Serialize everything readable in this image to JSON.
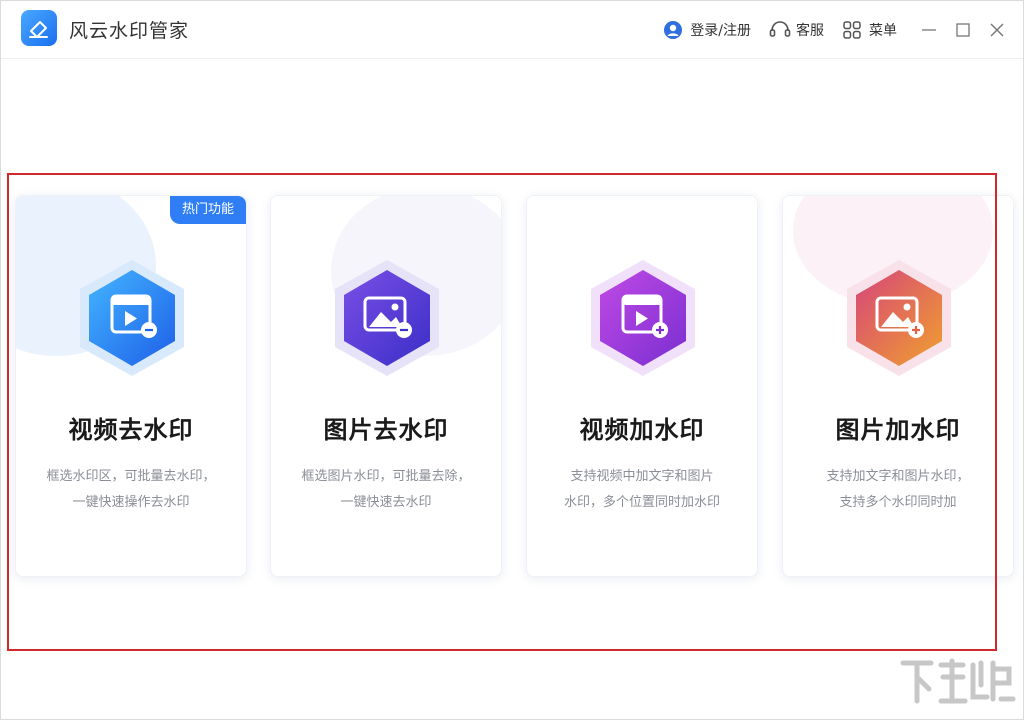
{
  "app": {
    "title": "风云水印管家"
  },
  "toolbar": {
    "login_label": "登录/注册",
    "service_label": "客服",
    "menu_label": "菜单"
  },
  "cards": [
    {
      "title": "视频去水印",
      "desc_line1": "框选水印区，可批量去水印，",
      "desc_line2": "一键快速操作去水印",
      "badge": "热门功能",
      "icon": "video-remove-icon",
      "accent": "#2f7ef5"
    },
    {
      "title": "图片去水印",
      "desc_line1": "框选图片水印，可批量去除，",
      "desc_line2": "一键快速去水印",
      "icon": "image-remove-icon",
      "accent": "#5b3ed6"
    },
    {
      "title": "视频加水印",
      "desc_line1": "支持视频中加文字和图片",
      "desc_line2": "水印，多个位置同时加水印",
      "icon": "video-add-icon",
      "accent": "#9b38d6"
    },
    {
      "title": "图片加水印",
      "desc_line1": "支持加文字和图片水印，",
      "desc_line2": "支持多个水印同时加",
      "icon": "image-add-icon",
      "accent": "#e0624a"
    }
  ],
  "colors": {
    "highlight_border": "#d3282b",
    "brand_blue": "#2f7ef5"
  }
}
